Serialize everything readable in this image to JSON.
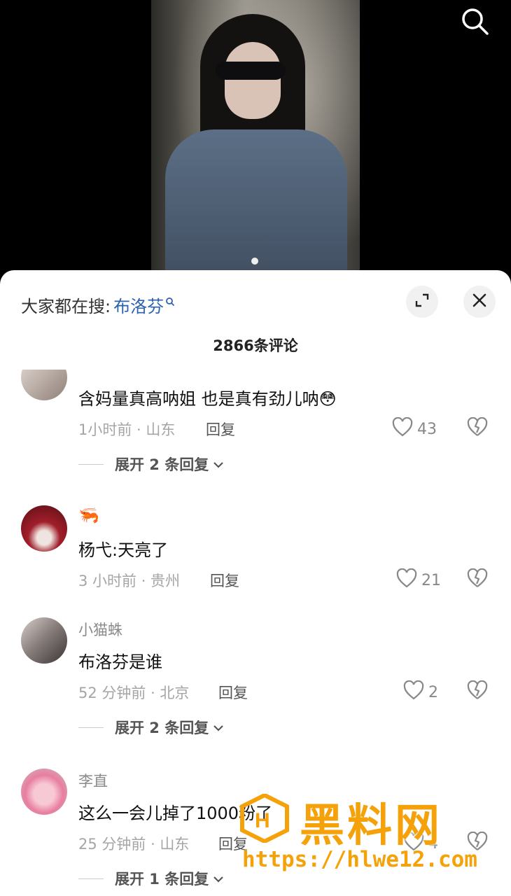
{
  "suggest": {
    "label": "大家都在搜:",
    "keyword": "布洛芬"
  },
  "comment_count": "2866条评论",
  "comments": [
    {
      "username": "",
      "text": "含妈量真高呐姐 也是真有劲儿呐",
      "emoji": "😳",
      "meta": "1小时前 · 山东",
      "reply": "回复",
      "likes": "43",
      "expand": "展开 2 条回复"
    },
    {
      "username": "🦐",
      "text": "杨弋:天亮了",
      "meta": "3 小时前 · 贵州",
      "reply": "回复",
      "likes": "21"
    },
    {
      "username": "小猫蛛",
      "text": "布洛芬是谁",
      "meta": "52 分钟前 · 北京",
      "reply": "回复",
      "likes": "2",
      "expand": "展开 2 条回复"
    },
    {
      "username": "李直",
      "text": "这么一会儿掉了1000粉了",
      "meta": "25 分钟前 · 山东",
      "reply": "回复",
      "likes": "4",
      "expand": "展开 1 条回复"
    }
  ],
  "watermark": {
    "title": "黑料网",
    "url": "https://hlwe12.com"
  },
  "icons": {
    "search": "search-icon",
    "expand": "expand-icon",
    "close": "close-icon",
    "like": "heart-icon",
    "dislike": "broken-heart-icon",
    "chevron": "chevron-down-icon"
  },
  "colors": {
    "keyword": "#2b62b0",
    "watermark": "#f5a20a"
  }
}
